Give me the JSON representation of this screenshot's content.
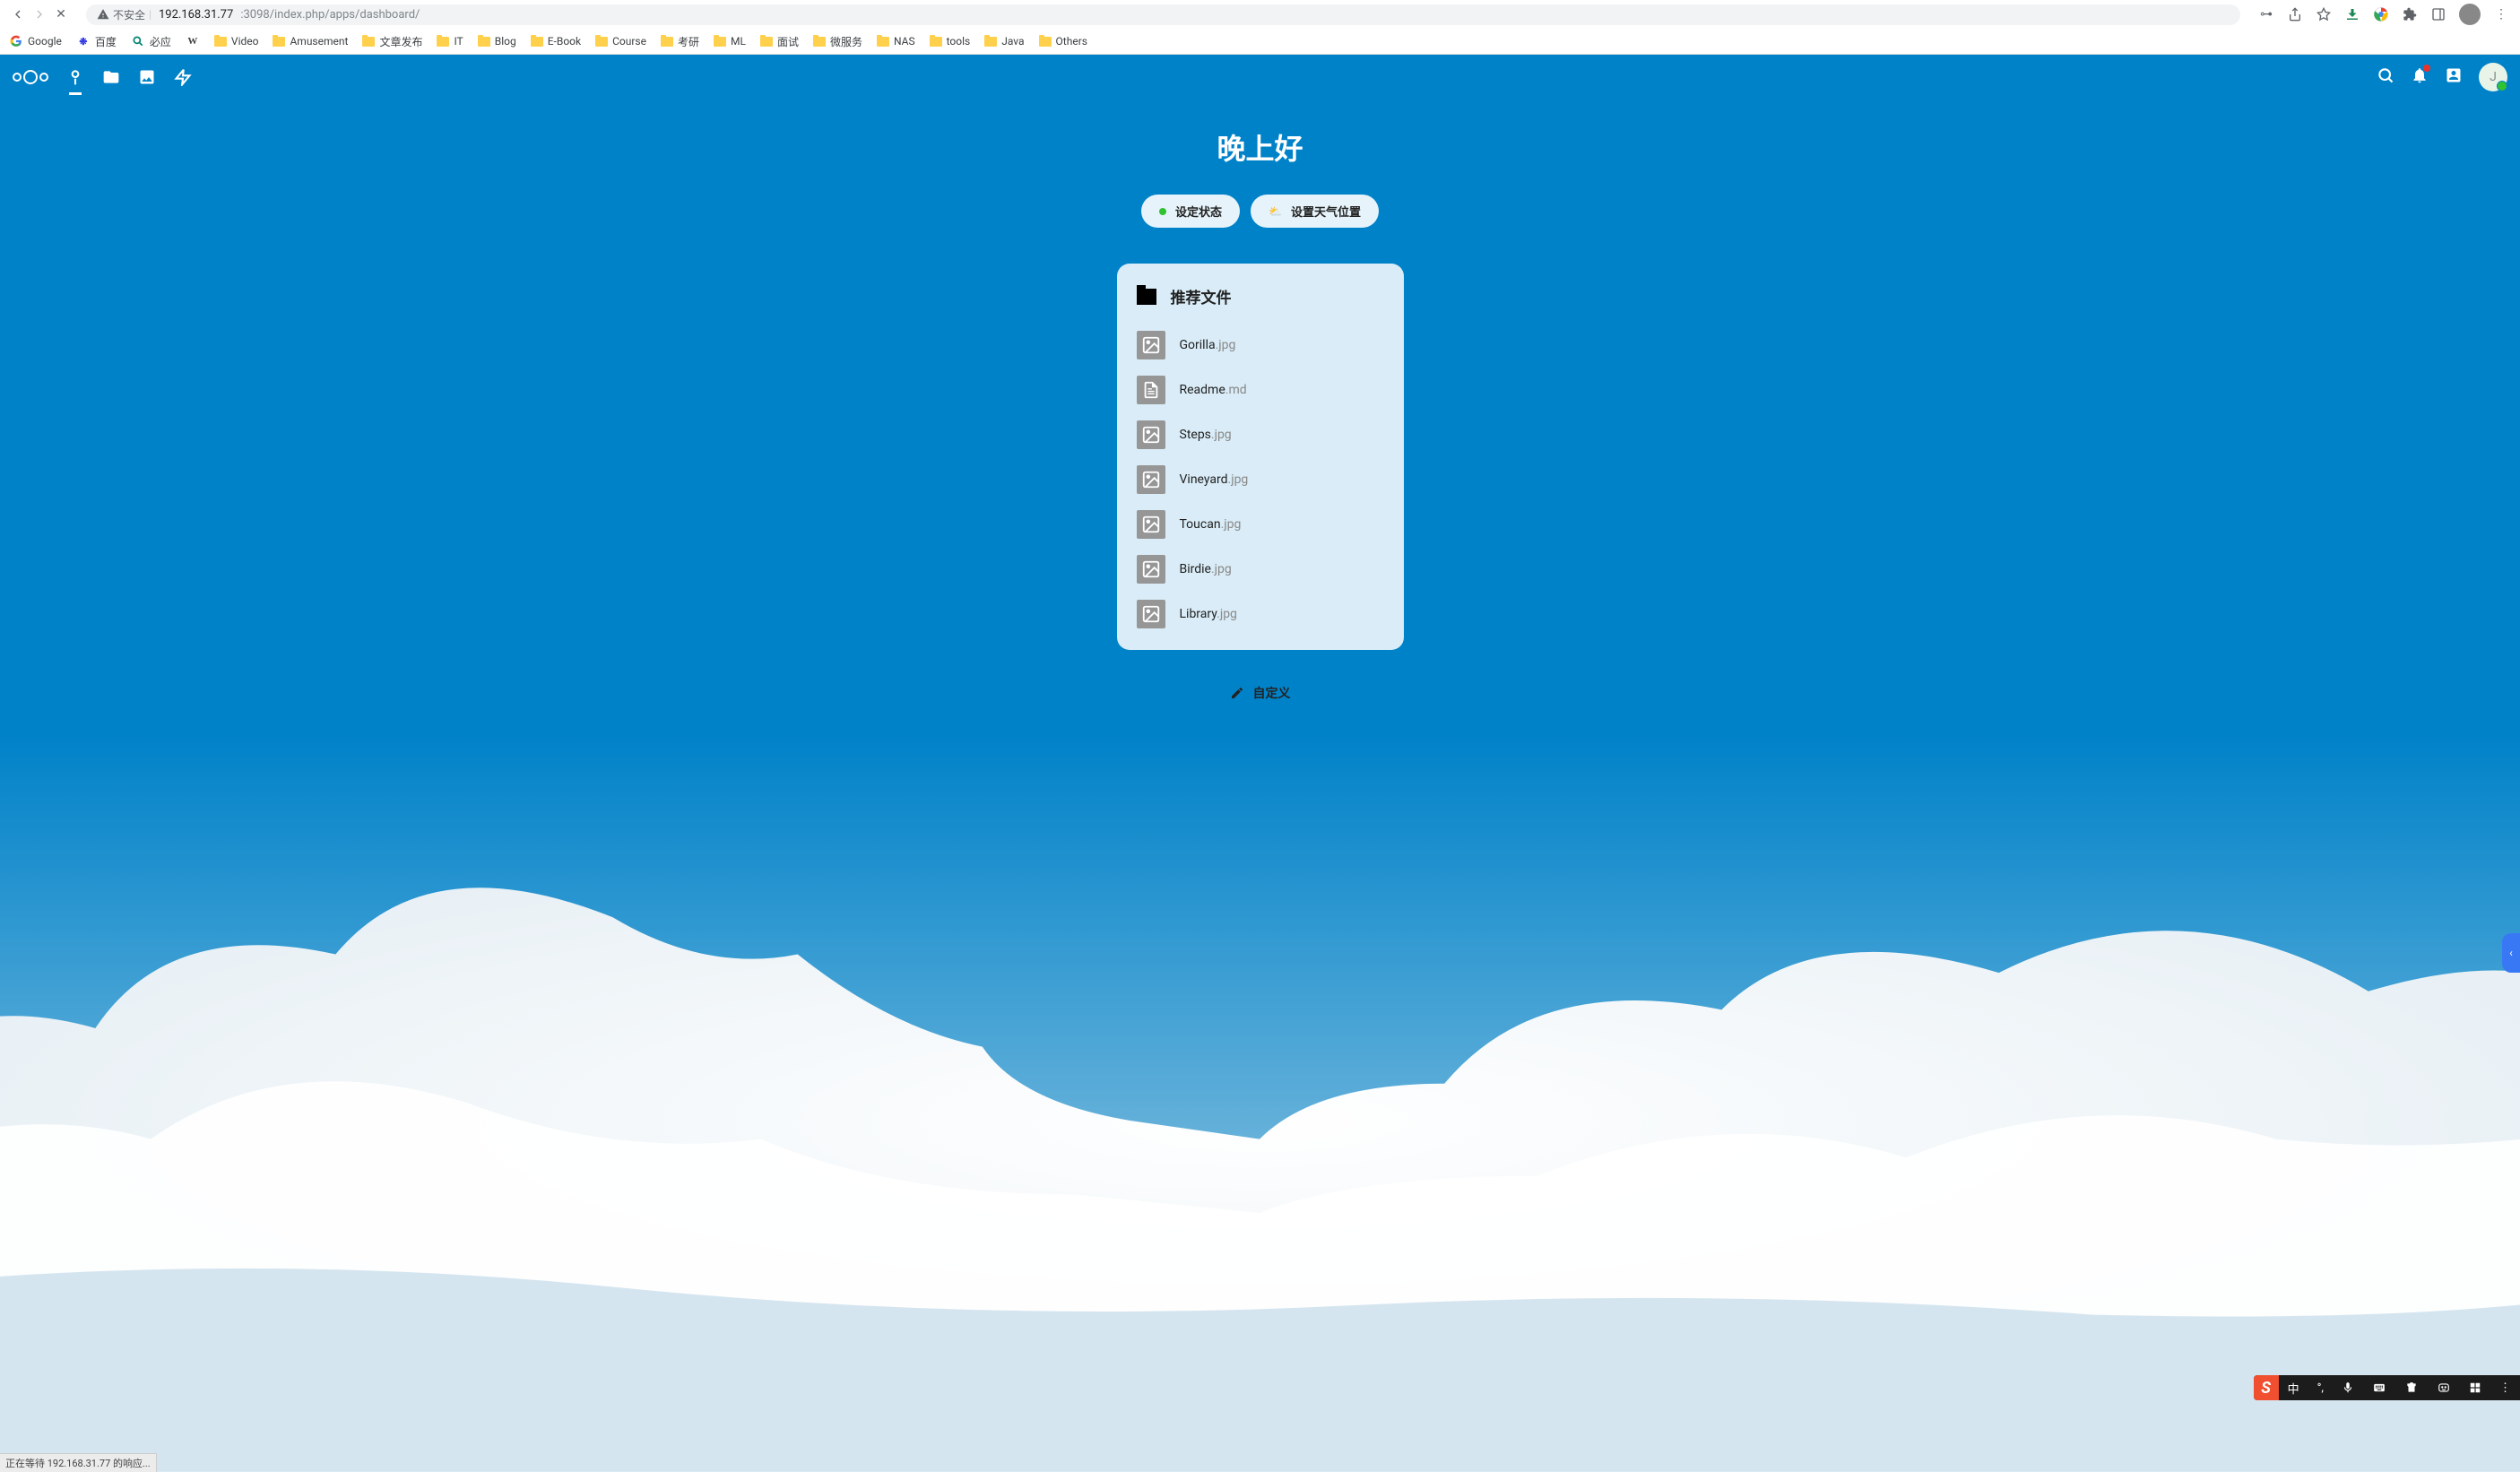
{
  "browser": {
    "security_text": "不安全",
    "url_host": "192.168.31.77",
    "url_port_path": ":3098/index.php/apps/dashboard/"
  },
  "bookmarks": [
    {
      "name": "Google",
      "type": "google"
    },
    {
      "name": "百度",
      "type": "baidu"
    },
    {
      "name": "必应",
      "type": "bing"
    },
    {
      "name": "W",
      "type": "wiki"
    },
    {
      "name": "Video",
      "type": "folder"
    },
    {
      "name": "Amusement",
      "type": "folder"
    },
    {
      "name": "文章发布",
      "type": "folder"
    },
    {
      "name": "IT",
      "type": "folder"
    },
    {
      "name": "Blog",
      "type": "folder"
    },
    {
      "name": "E-Book",
      "type": "folder"
    },
    {
      "name": "Course",
      "type": "folder"
    },
    {
      "name": "考研",
      "type": "folder"
    },
    {
      "name": "ML",
      "type": "folder"
    },
    {
      "name": "面试",
      "type": "folder"
    },
    {
      "name": "微服务",
      "type": "folder"
    },
    {
      "name": "NAS",
      "type": "folder"
    },
    {
      "name": "tools",
      "type": "folder"
    },
    {
      "name": "Java",
      "type": "folder"
    },
    {
      "name": "Others",
      "type": "folder"
    }
  ],
  "greeting": "晚上好",
  "status_button_label": "设定状态",
  "weather_button_label": "设置天气位置",
  "widget": {
    "title": "推荐文件",
    "files": [
      {
        "name": "Gorilla",
        "ext": ".jpg",
        "type": "image"
      },
      {
        "name": "Readme",
        "ext": ".md",
        "type": "doc"
      },
      {
        "name": "Steps",
        "ext": ".jpg",
        "type": "image"
      },
      {
        "name": "Vineyard",
        "ext": ".jpg",
        "type": "image"
      },
      {
        "name": "Toucan",
        "ext": ".jpg",
        "type": "image"
      },
      {
        "name": "Birdie",
        "ext": ".jpg",
        "type": "image"
      },
      {
        "name": "Library",
        "ext": ".jpg",
        "type": "image"
      }
    ]
  },
  "customize_label": "自定义",
  "ime_lang": "中",
  "avatar_letter": "J",
  "status_bar_text": "正在等待 192.168.31.77 的响应..."
}
